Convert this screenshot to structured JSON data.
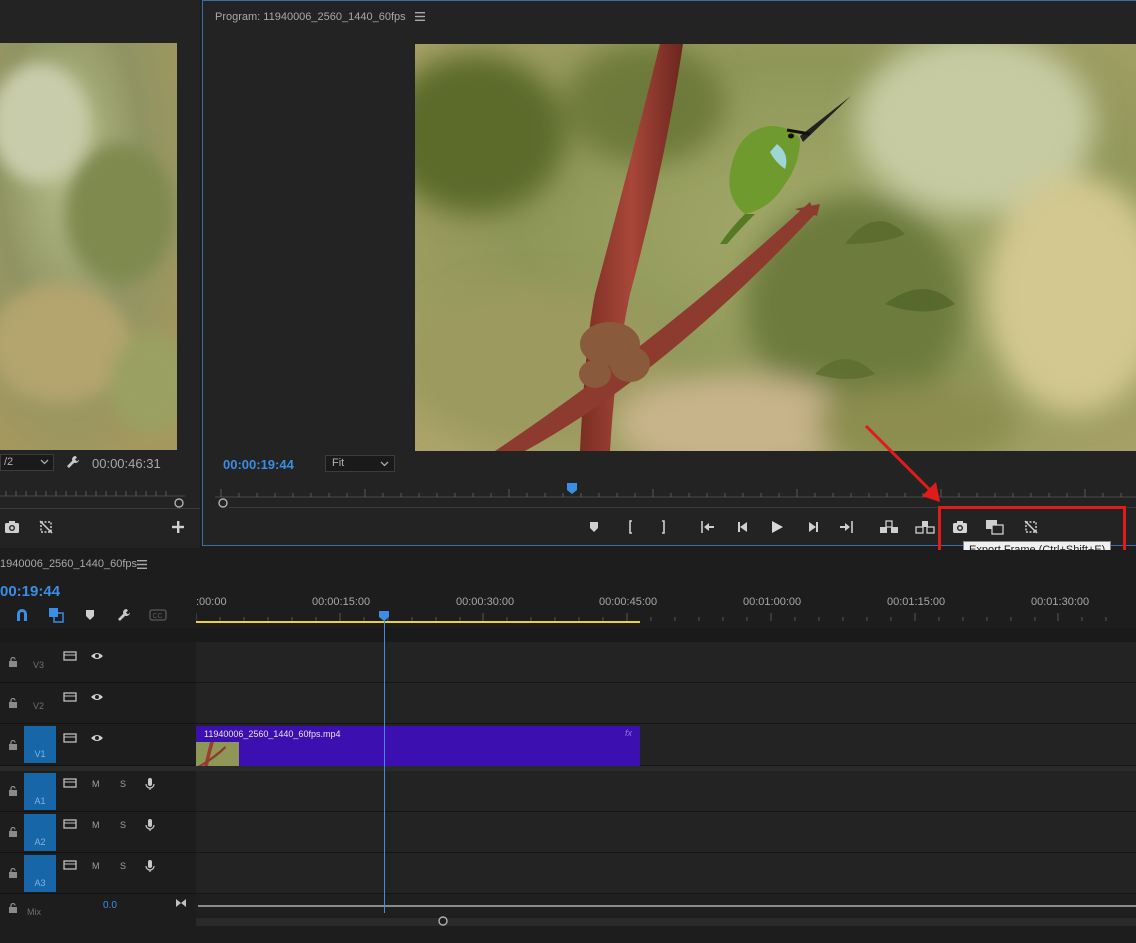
{
  "source_monitor": {
    "scale_value": "/2",
    "timecode": "00:00:46:31"
  },
  "program_monitor": {
    "title": "Program: 11940006_2560_1440_60fps",
    "menu_icon": "hamburger-icon",
    "timecode": "00:00:19:44",
    "fit_value": "Fit",
    "playhead_fraction": 0.39
  },
  "tooltip": {
    "text": "Export Frame (Ctrl+Shift+E)"
  },
  "timeline": {
    "sequence_name": "1940006_2560_1440_60fps",
    "timecode": "00:19:44",
    "ruler_labels": [
      ":00:00",
      "00:00:15:00",
      "00:00:30:00",
      "00:00:45:00",
      "00:01:00:00",
      "00:01:15:00",
      "00:01:30:00"
    ],
    "video_tracks": [
      {
        "label": "V3"
      },
      {
        "label": "V2"
      },
      {
        "label": "V1"
      }
    ],
    "audio_tracks": [
      {
        "label": "A1",
        "m": "M",
        "s": "S"
      },
      {
        "label": "A2",
        "m": "M",
        "s": "S"
      },
      {
        "label": "A3",
        "m": "M",
        "s": "S"
      }
    ],
    "mix": {
      "label": "Mix",
      "value": "0.0"
    },
    "clip": {
      "name": "11940006_2560_1440_60fps.mp4",
      "fx": "fx"
    }
  },
  "colors": {
    "accent_blue": "#3a8ee6",
    "clip_purple": "#3b0fb0",
    "highlight_red": "#e01b1b",
    "work_area_yellow": "#e8d23a"
  }
}
